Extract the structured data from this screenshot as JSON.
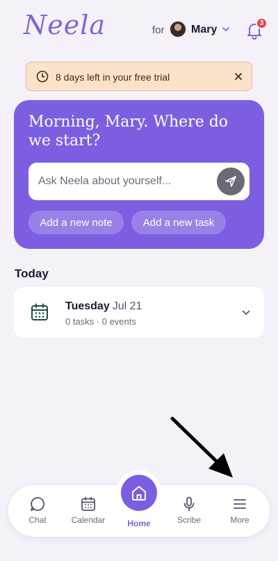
{
  "header": {
    "logo_text": "Neela",
    "for_label": "for",
    "user_name": "Mary",
    "notification_count": "3",
    "icons": {
      "user_menu": "chevron-down-icon",
      "notifications": "bell-icon"
    }
  },
  "trial_banner": {
    "text": "8 days left in your free trial",
    "icon": "clock-icon",
    "close_icon": "close-icon"
  },
  "hero": {
    "greeting": "Morning, Mary. Where do we start?",
    "ask_placeholder": "Ask Neela about yourself...",
    "send_icon": "send-icon",
    "chips": [
      "Add a new note",
      "Add a new task"
    ]
  },
  "today": {
    "heading": "Today",
    "day_name": "Tuesday",
    "date": "Jul 21",
    "summary": "0 tasks · 0 events",
    "icon": "calendar-icon"
  },
  "nav": {
    "items": [
      {
        "label": "Chat",
        "icon": "chat-icon"
      },
      {
        "label": "Calendar",
        "icon": "calendar-icon"
      },
      {
        "label": "Home",
        "icon": "home-icon",
        "active": true
      },
      {
        "label": "Scribe",
        "icon": "microphone-icon"
      },
      {
        "label": "More",
        "icon": "menu-icon"
      }
    ]
  },
  "colors": {
    "brand_purple": "#7c5fe1",
    "background": "#f4f1f9",
    "banner_bg": "#fbe3cb",
    "badge_red": "#e5434b"
  }
}
